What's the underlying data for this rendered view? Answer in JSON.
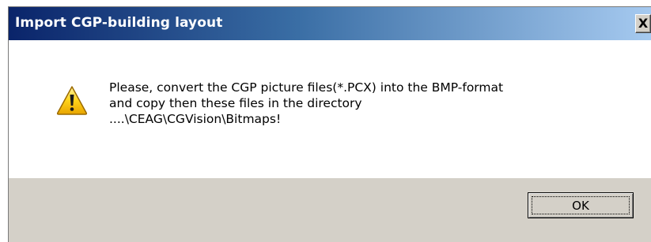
{
  "window": {
    "title": "Import CGP-building layout",
    "close_label": "X"
  },
  "message": {
    "icon": "warning-icon",
    "lines": [
      "Please, convert the CGP picture files(*.PCX) into the BMP-format",
      "and copy then these files in the directory",
      "....\\CEAG\\CGVision\\Bitmaps!"
    ]
  },
  "buttons": {
    "ok_label": "OK"
  },
  "colors": {
    "titlebar_start": "#0a246a",
    "titlebar_end": "#a6caf0",
    "dialog_face": "#d4d0c8",
    "content_background": "#ffffff",
    "warning_yellow": "#f5c400"
  }
}
